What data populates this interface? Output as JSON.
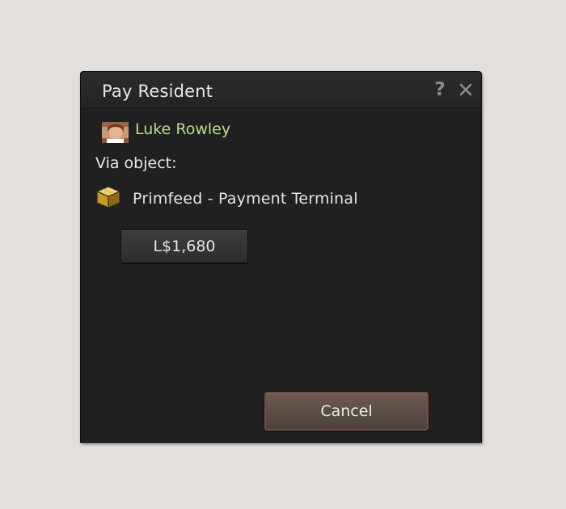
{
  "dialog": {
    "title": "Pay Resident",
    "help_icon": "help-icon",
    "close_icon": "close-icon"
  },
  "resident": {
    "name": "Luke Rowley",
    "avatar_icon": "avatar",
    "name_color": "#b9dc8a"
  },
  "via": {
    "label": "Via object:"
  },
  "object": {
    "icon": "box-icon",
    "name": "Primfeed - Payment Terminal"
  },
  "amount": {
    "label": "L$1,680"
  },
  "actions": {
    "cancel_label": "Cancel",
    "cancel_color": "#5c4c45"
  }
}
